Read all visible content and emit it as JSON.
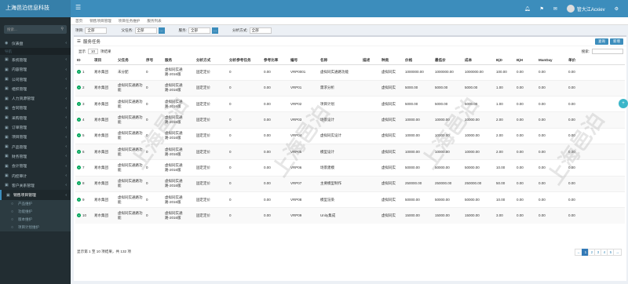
{
  "header": {
    "brand": "上海邑泊信息科技",
    "user": "管大江Acxiev"
  },
  "sidebar": {
    "search_placeholder": "搜索...",
    "dashboard": "仪表盘",
    "section": "导航",
    "items": [
      "系统管理",
      "内容管理",
      "公司管理",
      "组织管理",
      "人力资源管理",
      "合同管理",
      "采购管理",
      "订单管理",
      "项目管理",
      "产品管理",
      "财务管理",
      "会计管理",
      "内控审计",
      "客户关系管理",
      "销售项目管理"
    ],
    "sub": [
      "产品维护",
      "功能维护",
      "版本维护",
      "项目计划维护"
    ]
  },
  "breadcrumb": [
    "首页",
    "销售项目管理",
    "项目任务维护",
    "服务列表"
  ],
  "filters": [
    {
      "label": "项目:",
      "value": "全部"
    },
    {
      "label": "父任务:",
      "value": "全部"
    },
    {
      "label": "服务:",
      "value": "全部"
    },
    {
      "label": "分析方式:",
      "value": "全部"
    }
  ],
  "box": {
    "title": "服务任务",
    "query_btn": "查询",
    "new_btn": "新增"
  },
  "tools": {
    "show": "显示",
    "page_size": "10",
    "records": "项结果",
    "search_label": "搜索:"
  },
  "columns": [
    "ID",
    "项目",
    "父任务",
    "序号",
    "服务",
    "分析方式",
    "分析参考任务",
    "参考比率",
    "编号",
    "名称",
    "描述",
    "种类",
    "价格",
    "最低价",
    "成本",
    "BjD",
    "BjH",
    "ManDay",
    "单价"
  ],
  "rows": [
    {
      "id": "1",
      "project": "易水集团",
      "parent": "未分配",
      "seq": "0",
      "service": "虚拟同实通路-2016版",
      "method": "固定定价",
      "ref": "0",
      "ratio": "0.00",
      "code": "VRP0001",
      "name": "虚拟同实通路功能",
      "desc": "",
      "kind": "虚拟同实",
      "price": "1000000.00",
      "minp": "1000000.00",
      "cost": "1000000.00",
      "bjd": "100.00",
      "bjh": "0.00",
      "md": "0.00",
      "unit": "0.00"
    },
    {
      "id": "2",
      "project": "易水集团",
      "parent": "虚拟同实通路功能",
      "seq": "0",
      "service": "虚拟同实通路-2016版",
      "method": "固定定价",
      "ref": "0",
      "ratio": "0.00",
      "code": "VRP01",
      "name": "需求分析",
      "desc": "",
      "kind": "虚拟同实",
      "price": "5000.00",
      "minp": "5000.00",
      "cost": "5000.00",
      "bjd": "1.00",
      "bjh": "0.00",
      "md": "0.00",
      "unit": "0.00"
    },
    {
      "id": "3",
      "project": "易水集团",
      "parent": "虚拟同实通路功能",
      "seq": "0",
      "service": "虚拟同实通路-2016版",
      "method": "固定定价",
      "ref": "0",
      "ratio": "0.00",
      "code": "VRP02",
      "name": "项目计划",
      "desc": "",
      "kind": "虚拟同实",
      "price": "5000.00",
      "minp": "5000.00",
      "cost": "5000.00",
      "bjd": "1.00",
      "bjh": "0.00",
      "md": "0.00",
      "unit": "0.00"
    },
    {
      "id": "4",
      "project": "易水集团",
      "parent": "虚拟同实通路功能",
      "seq": "0",
      "service": "虚拟同实通路-2016版",
      "method": "固定定价",
      "ref": "0",
      "ratio": "0.00",
      "code": "VRP03",
      "name": "场景设计",
      "desc": "",
      "kind": "虚拟同实",
      "price": "10000.00",
      "minp": "10000.00",
      "cost": "10000.00",
      "bjd": "2.00",
      "bjh": "0.00",
      "md": "0.00",
      "unit": "0.00"
    },
    {
      "id": "5",
      "project": "易水集团",
      "parent": "虚拟同实通路功能",
      "seq": "0",
      "service": "虚拟同实通路-2016版",
      "method": "固定定价",
      "ref": "0",
      "ratio": "0.00",
      "code": "VRP04",
      "name": "虚拟同实设计",
      "desc": "",
      "kind": "虚拟同实",
      "price": "10000.00",
      "minp": "10000.00",
      "cost": "10000.00",
      "bjd": "2.00",
      "bjh": "0.00",
      "md": "0.00",
      "unit": "0.00"
    },
    {
      "id": "6",
      "project": "易水集团",
      "parent": "虚拟同实通路功能",
      "seq": "0",
      "service": "虚拟同实通路-2016版",
      "method": "固定定价",
      "ref": "0",
      "ratio": "0.00",
      "code": "VRP05",
      "name": "模型设计",
      "desc": "",
      "kind": "虚拟同实",
      "price": "10000.00",
      "minp": "10000.00",
      "cost": "10000.00",
      "bjd": "2.00",
      "bjh": "0.00",
      "md": "0.00",
      "unit": "0.00"
    },
    {
      "id": "7",
      "project": "易水集团",
      "parent": "虚拟同实通路功能",
      "seq": "0",
      "service": "虚拟同实通路-2016版",
      "method": "固定定价",
      "ref": "0",
      "ratio": "0.00",
      "code": "VRP06",
      "name": "场景建模",
      "desc": "",
      "kind": "虚拟同实",
      "price": "50000.00",
      "minp": "50000.00",
      "cost": "50000.00",
      "bjd": "10.00",
      "bjh": "0.00",
      "md": "0.00",
      "unit": "0.00"
    },
    {
      "id": "8",
      "project": "易水集团",
      "parent": "虚拟同实通路功能",
      "seq": "0",
      "service": "虚拟同实通路-2016版",
      "method": "固定定价",
      "ref": "0",
      "ratio": "0.00",
      "code": "VRP07",
      "name": "主要模型制作",
      "desc": "",
      "kind": "虚拟同实",
      "price": "250000.00",
      "minp": "250000.00",
      "cost": "250000.00",
      "bjd": "50.00",
      "bjh": "0.00",
      "md": "0.00",
      "unit": "0.00"
    },
    {
      "id": "9",
      "project": "易水集团",
      "parent": "虚拟同实通路功能",
      "seq": "0",
      "service": "虚拟同实通路-2016版",
      "method": "固定定价",
      "ref": "0",
      "ratio": "0.00",
      "code": "VRP08",
      "name": "模型渲染",
      "desc": "",
      "kind": "虚拟同实",
      "price": "50000.00",
      "minp": "50000.00",
      "cost": "50000.00",
      "bjd": "10.00",
      "bjh": "0.00",
      "md": "0.00",
      "unit": "0.00"
    },
    {
      "id": "10",
      "project": "易水集团",
      "parent": "虚拟同实通路功能",
      "seq": "0",
      "service": "虚拟同实通路-2016版",
      "method": "固定定价",
      "ref": "0",
      "ratio": "0.00",
      "code": "VRP09",
      "name": "Unity集成",
      "desc": "",
      "kind": "虚拟同实",
      "price": "15000.00",
      "minp": "15000.00",
      "cost": "15000.00",
      "bjd": "3.00",
      "bjh": "0.00",
      "md": "0.00",
      "unit": "0.00"
    }
  ],
  "footer": "显示第 1 至 10 项结果，共 132 项",
  "pager": [
    "←",
    "1",
    "2",
    "3",
    "4",
    "5",
    "→"
  ],
  "watermark": "上海邑泊"
}
